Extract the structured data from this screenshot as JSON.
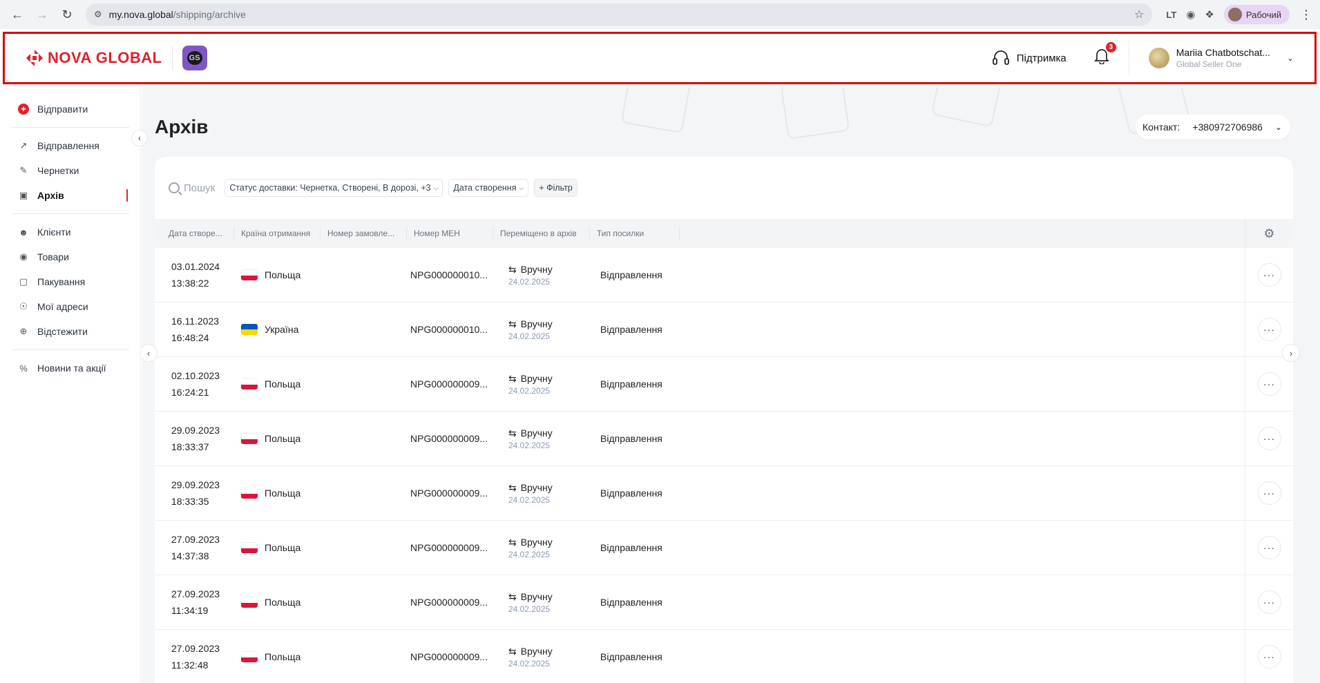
{
  "browser": {
    "url_host": "my.nova.global",
    "url_path": "/shipping/archive",
    "profile_label": "Рабочий"
  },
  "header": {
    "logo_text": "NOVA GLOBAL",
    "badge_text": "GS",
    "support_label": "Підтримка",
    "notifications_count": "3",
    "user_name": "Mariia Chatbotschat...",
    "user_company": "Global Seller One"
  },
  "sidebar": {
    "send_label": "Відправити",
    "items_group1": [
      {
        "label": "Відправлення",
        "icon": "arrow-up-right-icon"
      },
      {
        "label": "Чернетки",
        "icon": "edit-icon"
      },
      {
        "label": "Архів",
        "icon": "archive-icon"
      }
    ],
    "items_group2": [
      {
        "label": "Клієнти",
        "icon": "users-icon"
      },
      {
        "label": "Товари",
        "icon": "tag-icon"
      },
      {
        "label": "Пакування",
        "icon": "box-icon"
      },
      {
        "label": "Мої адреси",
        "icon": "location-icon"
      },
      {
        "label": "Відстежити",
        "icon": "target-icon"
      }
    ],
    "items_group3": [
      {
        "label": "Новини та акції",
        "icon": "percent-icon"
      }
    ]
  },
  "page": {
    "title": "Архів",
    "contact_label": "Контакт:",
    "contact_value": "+380972706986"
  },
  "filters": {
    "search_placeholder": "Пошук",
    "status_chip": "Статус доставки: Чернетка, Створені, В дорозі, +3",
    "date_chip": "Дата створення",
    "add_filter": "+ Фільтр"
  },
  "table": {
    "columns": [
      "Дата створе...",
      "Країна отримання",
      "Номер замовле...",
      "Номер МЕН",
      "Переміщено в архів",
      "Тип посилки"
    ],
    "rows": [
      {
        "date": "03.01.2024",
        "time": "13:38:22",
        "country": "Польща",
        "flag": "pl",
        "meh": "NPG000000010...",
        "moved": "Вручну",
        "moved_date": "24.02.2025",
        "type": "Відправлення"
      },
      {
        "date": "16.11.2023",
        "time": "16:48:24",
        "country": "Україна",
        "flag": "ua",
        "meh": "NPG000000010...",
        "moved": "Вручну",
        "moved_date": "24.02.2025",
        "type": "Відправлення"
      },
      {
        "date": "02.10.2023",
        "time": "16:24:21",
        "country": "Польща",
        "flag": "pl",
        "meh": "NPG000000009...",
        "moved": "Вручну",
        "moved_date": "24.02.2025",
        "type": "Відправлення"
      },
      {
        "date": "29.09.2023",
        "time": "18:33:37",
        "country": "Польща",
        "flag": "pl",
        "meh": "NPG000000009...",
        "moved": "Вручну",
        "moved_date": "24.02.2025",
        "type": "Відправлення"
      },
      {
        "date": "29.09.2023",
        "time": "18:33:35",
        "country": "Польща",
        "flag": "pl",
        "meh": "NPG000000009...",
        "moved": "Вручну",
        "moved_date": "24.02.2025",
        "type": "Відправлення"
      },
      {
        "date": "27.09.2023",
        "time": "14:37:38",
        "country": "Польща",
        "flag": "pl",
        "meh": "NPG000000009...",
        "moved": "Вручну",
        "moved_date": "24.02.2025",
        "type": "Відправлення"
      },
      {
        "date": "27.09.2023",
        "time": "11:34:19",
        "country": "Польща",
        "flag": "pl",
        "meh": "NPG000000009...",
        "moved": "Вручну",
        "moved_date": "24.02.2025",
        "type": "Відправлення"
      },
      {
        "date": "27.09.2023",
        "time": "11:32:48",
        "country": "Польща",
        "flag": "pl",
        "meh": "NPG000000009...",
        "moved": "Вручну",
        "moved_date": "24.02.2025",
        "type": "Відправлення"
      }
    ]
  },
  "colors": {
    "brand_red": "#e0212d",
    "highlight_border": "#d90000",
    "badge_purple": "#7e57c2"
  }
}
